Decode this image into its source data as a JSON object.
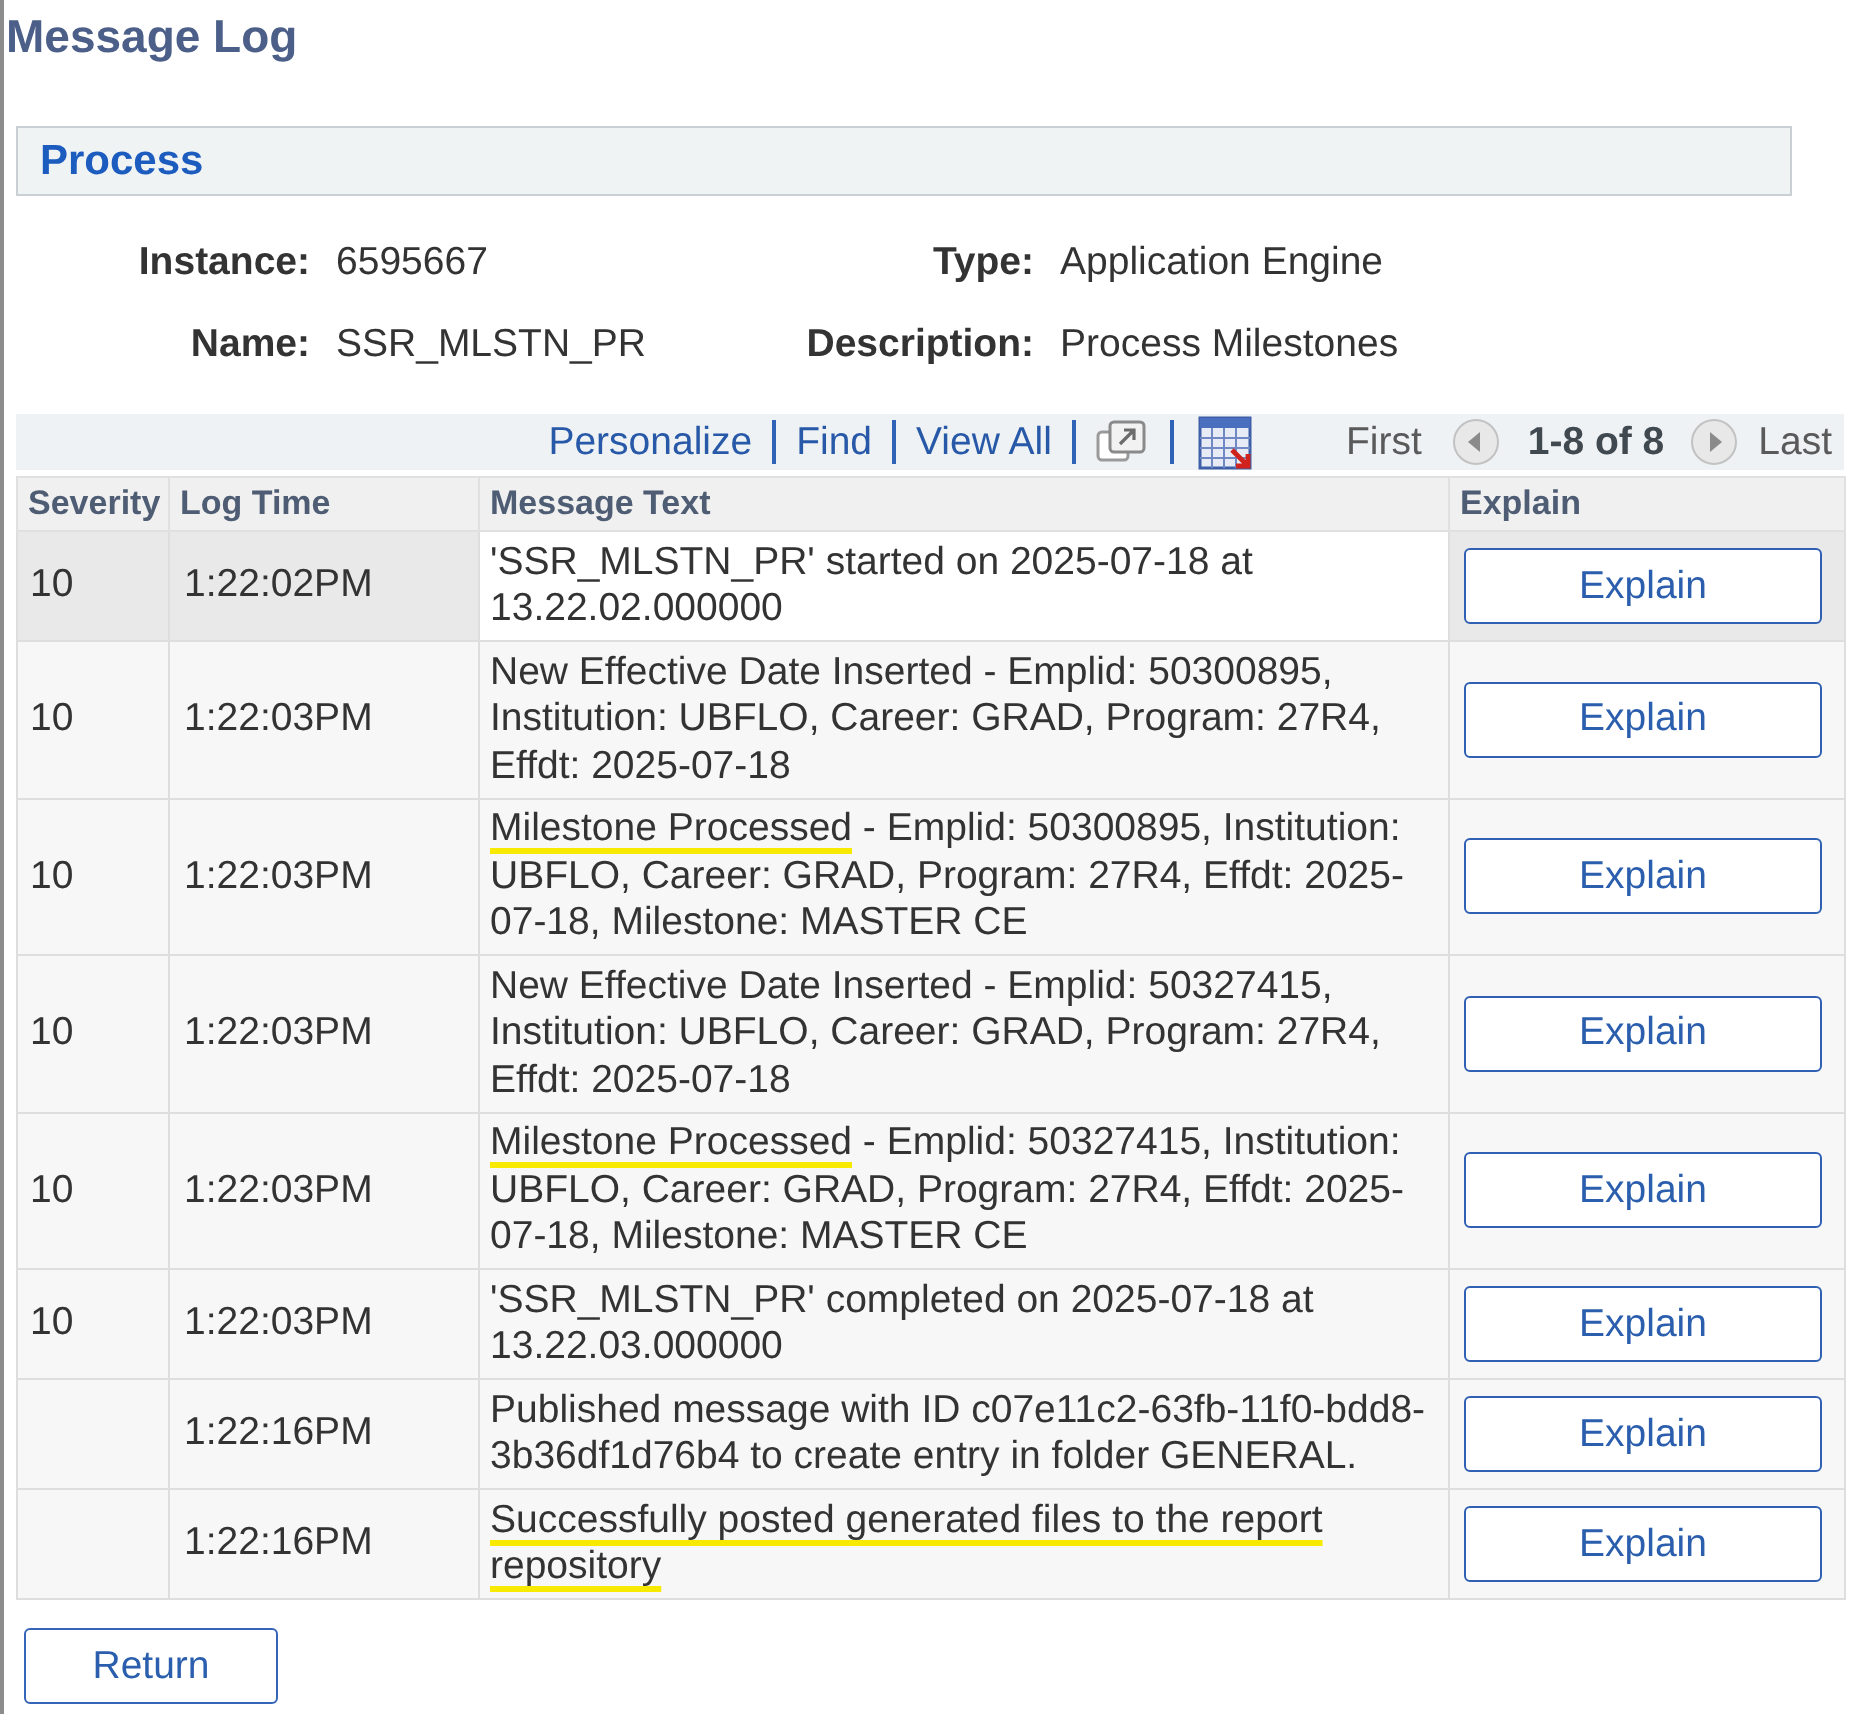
{
  "page": {
    "title": "Message Log"
  },
  "process": {
    "heading": "Process",
    "fields": [
      {
        "label": "Instance:",
        "value": "6595667"
      },
      {
        "label": "Type:",
        "value": "Application Engine"
      },
      {
        "label": "Name:",
        "value": "SSR_MLSTN_PR"
      },
      {
        "label": "Description:",
        "value": "Process Milestones"
      }
    ]
  },
  "grid": {
    "toolbar": {
      "links": [
        "Personalize",
        "Find",
        "View All"
      ],
      "first": {
        "label": "First",
        "disabled": true
      },
      "previous": {
        "disabled": true
      },
      "range": "1-8 of 8",
      "next": {
        "disabled": true
      },
      "last": {
        "label": "Last",
        "disabled": true
      }
    },
    "columns": [
      "Severity",
      "Log Time",
      "Message Text",
      "Explain"
    ],
    "rows": [
      {
        "severity": "10",
        "time": "1:22:02PM",
        "message": [
          {
            "text": "'SSR_MLSTN_PR' started on 2025-07-18 at 13.22.02.000000",
            "marked": false
          }
        ],
        "button": "Explain",
        "selected": true
      },
      {
        "severity": "10",
        "time": "1:22:03PM",
        "message": [
          {
            "text": "New Effective Date Inserted - Emplid: 50300895, Institution: UBFLO, Career: GRAD, Program: 27R4, Effdt: 2025-07-18",
            "marked": false
          }
        ],
        "button": "Explain",
        "selected": false
      },
      {
        "severity": "10",
        "time": "1:22:03PM",
        "message": [
          {
            "text": "Milestone Processed",
            "marked": true
          },
          {
            "text": " - Emplid: 50300895, Institution: UBFLO, Career: GRAD, Program: 27R4, Effdt: 2025-07-18, Milestone: MASTER CE",
            "marked": false
          }
        ],
        "button": "Explain",
        "selected": false
      },
      {
        "severity": "10",
        "time": "1:22:03PM",
        "message": [
          {
            "text": "New Effective Date Inserted - Emplid: 50327415, Institution: UBFLO, Career: GRAD, Program: 27R4, Effdt: 2025-07-18",
            "marked": false
          }
        ],
        "button": "Explain",
        "selected": false
      },
      {
        "severity": "10",
        "time": "1:22:03PM",
        "message": [
          {
            "text": "Milestone Processed",
            "marked": true
          },
          {
            "text": " - Emplid: 50327415, Institution: UBFLO, Career: GRAD, Program: 27R4, Effdt: 2025-07-18, Milestone: MASTER CE",
            "marked": false
          }
        ],
        "button": "Explain",
        "selected": false
      },
      {
        "severity": "10",
        "time": "1:22:03PM",
        "message": [
          {
            "text": "'SSR_MLSTN_PR' completed on 2025-07-18 at 13.22.03.000000",
            "marked": false
          }
        ],
        "button": "Explain",
        "selected": false
      },
      {
        "time": "1:22:16PM",
        "message": [
          {
            "text": "Published message with ID c07e11c2-63fb-11f0-bdd8-3b36df1d76b4 to create entry in folder GENERAL.",
            "marked": false
          }
        ],
        "button": "Explain",
        "selected": false
      },
      {
        "time": "1:22:16PM",
        "message": [
          {
            "text": "Successfully posted generated files to the report repository",
            "marked": true
          }
        ],
        "button": "Explain",
        "selected": false
      }
    ]
  },
  "return_button": "Return"
}
